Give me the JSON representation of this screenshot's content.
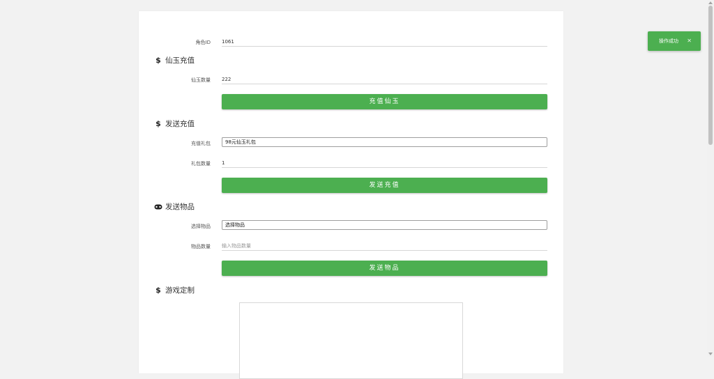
{
  "form": {
    "role_id": {
      "label": "角色ID",
      "value": "1061"
    },
    "sections": {
      "jade": {
        "icon": "dollar-icon",
        "title": "仙玉充值",
        "qty_label": "仙玉数量",
        "qty_value": "222",
        "button": "充值仙玉"
      },
      "recharge": {
        "icon": "dollar-icon",
        "title": "发送充值",
        "package_label": "充值礼包",
        "package_value": "98元仙玉礼包",
        "count_label": "礼包数量",
        "count_value": "1",
        "button": "发送充值"
      },
      "items": {
        "icon": "gamepad-icon",
        "title": "发送物品",
        "select_label": "选择物品",
        "select_value": "选择物品",
        "qty_label": "物品数量",
        "qty_placeholder": "输入物品数量",
        "button": "发送物品"
      },
      "custom": {
        "icon": "dollar-icon",
        "title": "游戏定制"
      }
    }
  },
  "toast": {
    "message": "操作成功",
    "close_icon": "close-icon"
  },
  "colors": {
    "accent": "#4caf50",
    "background": "#f2f2f2",
    "card": "#ffffff"
  }
}
